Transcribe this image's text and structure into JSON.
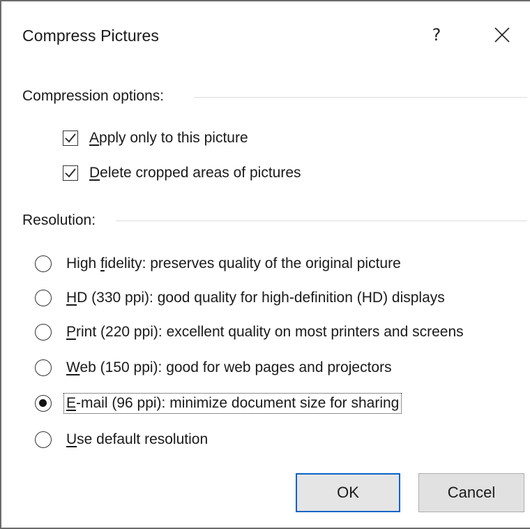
{
  "dialog": {
    "title": "Compress Pictures",
    "help_label": "?",
    "close_icon": "close-icon"
  },
  "compression": {
    "header": "Compression options:",
    "options": [
      {
        "mnemonic": "A",
        "rest": "pply only to this picture",
        "checked": true
      },
      {
        "mnemonic": "D",
        "rest": "elete cropped areas of pictures",
        "checked": true
      }
    ]
  },
  "resolution": {
    "header": "Resolution:",
    "options": [
      {
        "before": "High ",
        "mnemonic": "f",
        "rest": "idelity: preserves quality of the original picture",
        "selected": false
      },
      {
        "before": "",
        "mnemonic": "H",
        "rest": "D (330 ppi): good quality for high-definition (HD) displays",
        "selected": false
      },
      {
        "before": "",
        "mnemonic": "P",
        "rest": "rint (220 ppi): excellent quality on most printers and screens",
        "selected": false
      },
      {
        "before": "",
        "mnemonic": "W",
        "rest": "eb (150 ppi): good for web pages and projectors",
        "selected": false
      },
      {
        "before": "",
        "mnemonic": "E",
        "rest": "-mail (96 ppi): minimize document size for sharing",
        "selected": true
      },
      {
        "before": "",
        "mnemonic": "U",
        "rest": "se default resolution",
        "selected": false
      }
    ]
  },
  "buttons": {
    "ok": "OK",
    "cancel": "Cancel"
  },
  "colors": {
    "ok_border": "#0a64c8",
    "button_bg": "#e1e1e1",
    "separator": "#dcdcdc"
  }
}
